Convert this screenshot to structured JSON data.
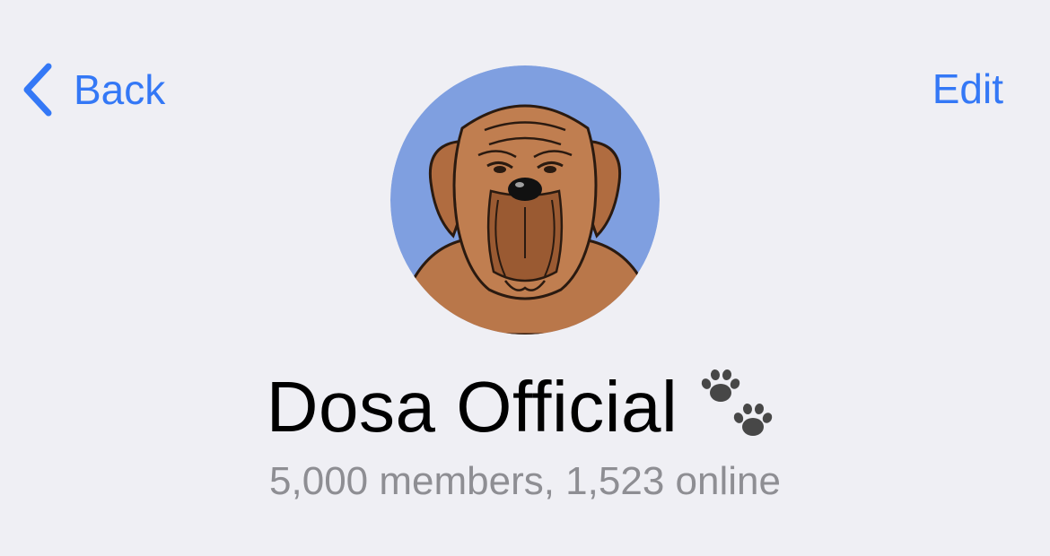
{
  "nav": {
    "back_label": "Back",
    "edit_label": "Edit",
    "icons": {
      "back": "chevron-left-icon"
    }
  },
  "profile": {
    "avatar_description": "cartoon dog avatar",
    "title": "Dosa Official",
    "title_icon": "paw-prints-icon",
    "members": "5,000 members, 1,523 online"
  },
  "colors": {
    "accent": "#3478f6",
    "background": "#efeff4",
    "secondary_text": "#8e8e93",
    "avatar_bg": "#7f9fe0",
    "dog_fur": "#b9774a"
  }
}
